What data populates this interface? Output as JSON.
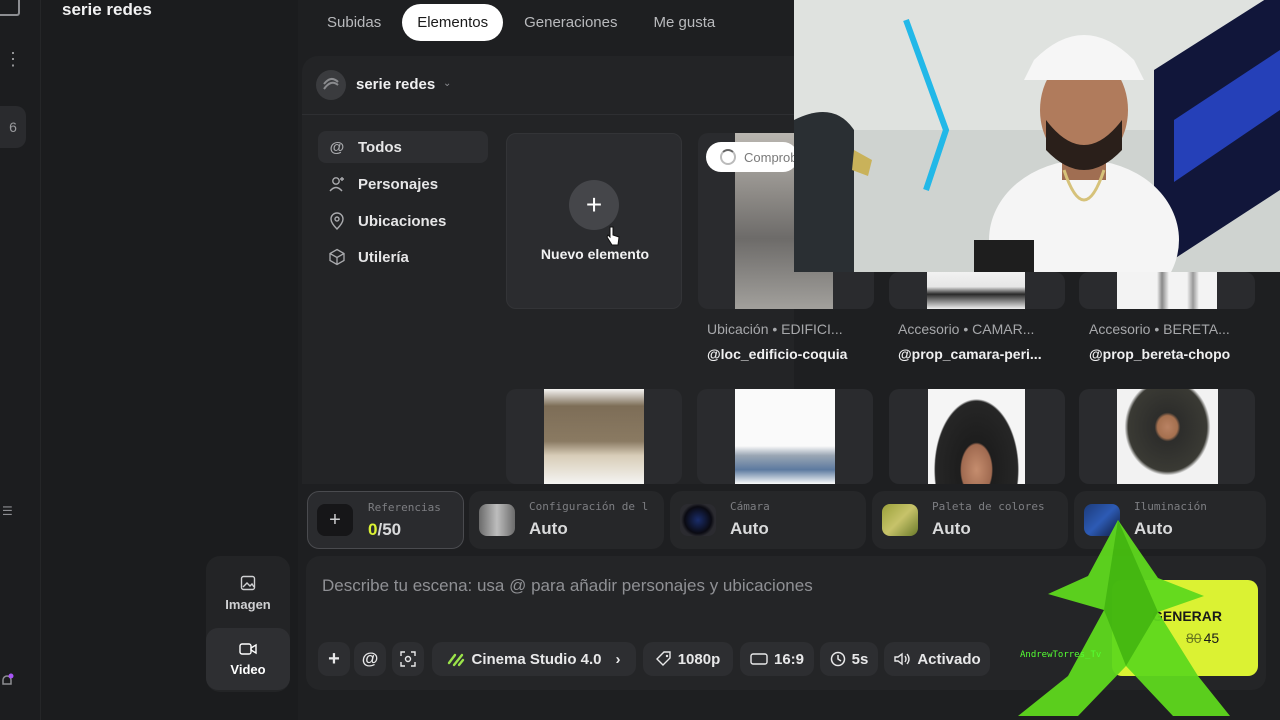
{
  "project": {
    "title": "serie redes",
    "name": "serie redes"
  },
  "rail": {
    "badge": "6"
  },
  "tabs": [
    {
      "label": "Subidas",
      "active": false
    },
    {
      "label": "Elementos",
      "active": true
    },
    {
      "label": "Generaciones",
      "active": false
    },
    {
      "label": "Me gusta",
      "active": false
    }
  ],
  "categories": [
    {
      "label": "Todos",
      "icon": "at-icon",
      "active": true
    },
    {
      "label": "Personajes",
      "icon": "person-add-icon",
      "active": false
    },
    {
      "label": "Ubicaciones",
      "icon": "location-pin-icon",
      "active": false
    },
    {
      "label": "Utilería",
      "icon": "cube-icon",
      "active": false
    }
  ],
  "new_element": {
    "label": "Nuevo elemento"
  },
  "checking_pill": {
    "label": "Comprob"
  },
  "items_row1": [
    {
      "type": "Ubicación • EDIFICI...",
      "tag": "@loc_edificio-coquia"
    },
    {
      "type": "Accesorio • CAMAR...",
      "tag": "@prop_camara-peri..."
    },
    {
      "type": "Accesorio • BERETA...",
      "tag": "@prop_bereta-chopo"
    }
  ],
  "settings": {
    "references": {
      "label": "Referencias",
      "used": "0",
      "total": "/50"
    },
    "config": {
      "label": "Configuración de l",
      "value": "Auto"
    },
    "camera": {
      "label": "Cámara",
      "value": "Auto"
    },
    "palette": {
      "label": "Paleta de colores",
      "value": "Auto"
    },
    "lighting": {
      "label": "Iluminación",
      "value": "Auto"
    }
  },
  "prompt": {
    "placeholder": "Describe tu escena: usa @ para añadir personajes y ubicaciones"
  },
  "toolbar": {
    "model": "Cinema Studio 4.0",
    "resolution": "1080p",
    "aspect": "16:9",
    "duration": "5s",
    "audio": "Activado"
  },
  "generate": {
    "label": "GENERAR",
    "old_cost": "80",
    "cost": "45"
  },
  "modes": [
    {
      "label": "Imagen",
      "active": false
    },
    {
      "label": "Video",
      "active": true
    }
  ],
  "watermark": "AndrewTorres_Tv",
  "colors": {
    "accent": "#dbf233",
    "background": "#1b1c1e",
    "panel": "#232426"
  }
}
